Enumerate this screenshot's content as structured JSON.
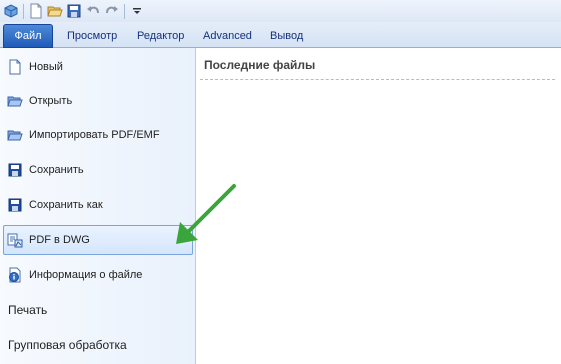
{
  "quick_access": {
    "icons": [
      "app-icon",
      "new-doc-icon",
      "open-folder-icon",
      "save-icon",
      "undo-icon",
      "redo-icon",
      "customize-dropdown-icon"
    ]
  },
  "tabs": [
    {
      "label": "Файл",
      "active": true
    },
    {
      "label": "Просмотр"
    },
    {
      "label": "Редактор"
    },
    {
      "label": "Advanced"
    },
    {
      "label": "Вывод"
    }
  ],
  "sidebar": {
    "items": [
      {
        "label": "Новый",
        "icon": "new-doc-icon"
      },
      {
        "label": "Открыть",
        "icon": "open-folder-icon"
      },
      {
        "label": "Импортировать PDF/EMF",
        "icon": "import-pdf-icon"
      },
      {
        "label": "Сохранить",
        "icon": "save-icon"
      },
      {
        "label": "Сохранить как",
        "icon": "save-as-icon"
      },
      {
        "label": "PDF в DWG",
        "icon": "pdf-to-dwg-icon",
        "selected": true
      },
      {
        "label": "Информация о файле",
        "icon": "info-icon"
      },
      {
        "label": "Печать"
      },
      {
        "label": "Групповая обработка"
      }
    ]
  },
  "content": {
    "title": "Последние файлы"
  },
  "annotation": {
    "arrow_color": "#3aa53a",
    "icon": "green-arrow-icon"
  },
  "colors": {
    "file_tab": "#2a63c0",
    "selected_border": "#7aa4dc",
    "tab_text": "#15317e"
  }
}
